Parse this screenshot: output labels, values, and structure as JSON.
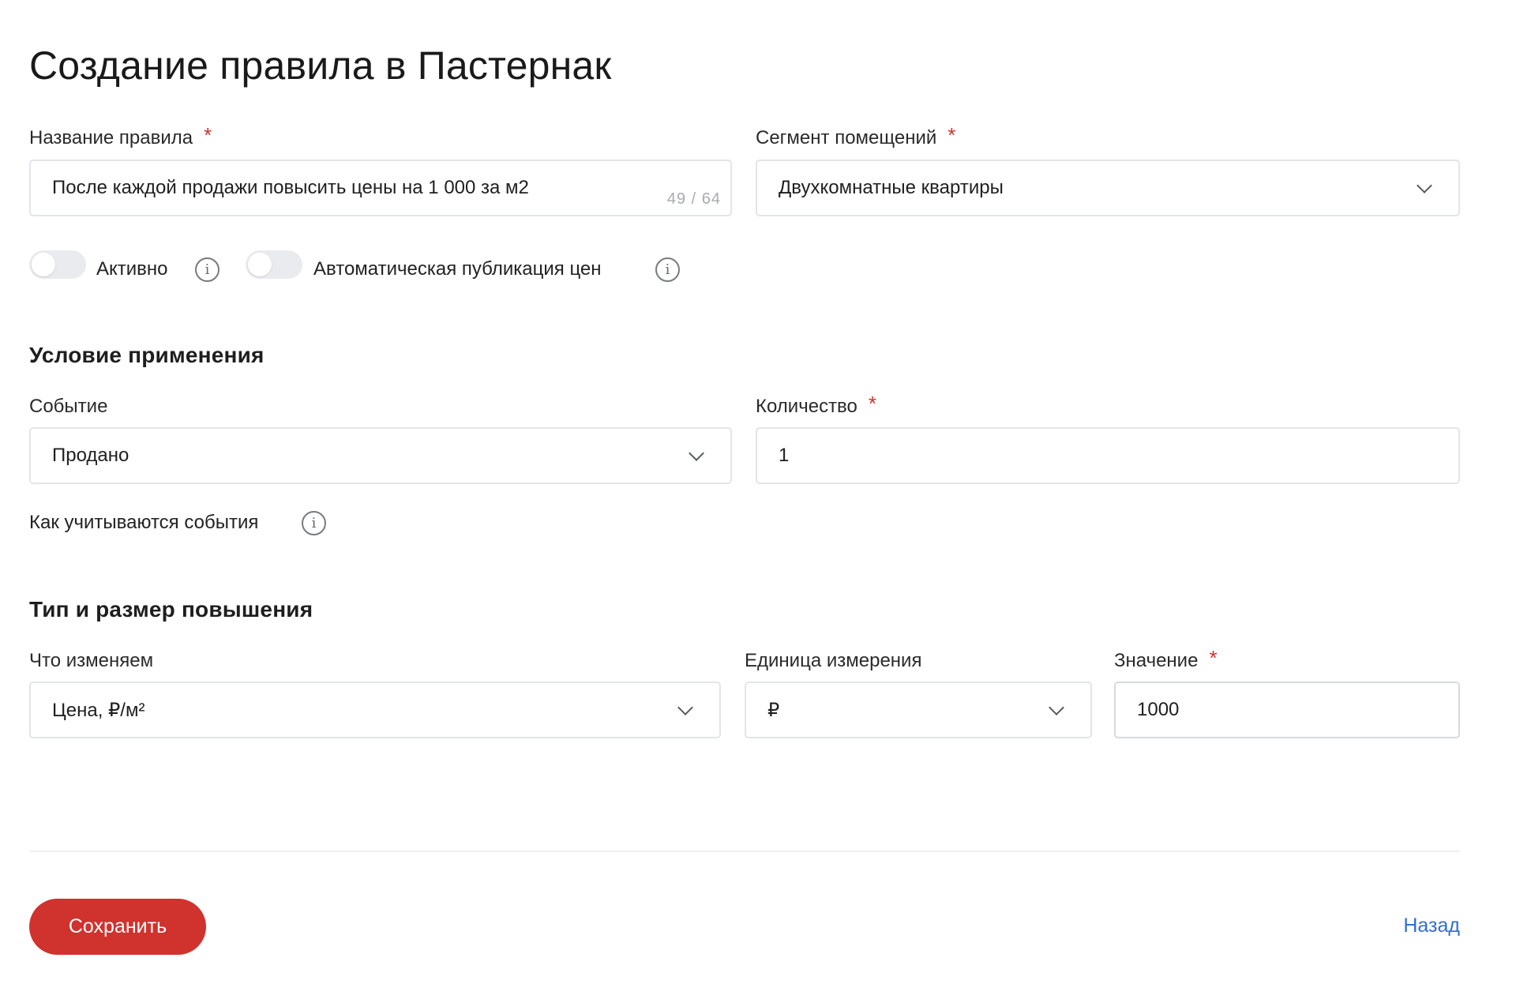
{
  "page": {
    "title": "Создание правила в Пастернак"
  },
  "rule_name": {
    "label": "Название правила",
    "value": "После каждой продажи повысить цены на 1 000 за м2",
    "counter": "49 / 64"
  },
  "segment": {
    "label": "Сегмент помещений",
    "value": "Двухкомнатные квартиры"
  },
  "toggles": {
    "active": {
      "label": "Активно",
      "on": false
    },
    "auto_publish": {
      "label": "Автоматическая публикация цен",
      "on": false
    }
  },
  "condition": {
    "title": "Условие применения",
    "event": {
      "label": "Событие",
      "value": "Продано"
    },
    "quantity": {
      "label": "Количество",
      "value": "1"
    },
    "events_hint": "Как учитываются события"
  },
  "increase": {
    "title": "Тип и размер повышения",
    "what": {
      "label": "Что изменяем",
      "value": "Цена, ₽/м²"
    },
    "unit": {
      "label": "Единица измерения",
      "value": "₽"
    },
    "amount": {
      "label": "Значение",
      "value": "1000"
    }
  },
  "actions": {
    "save_label": "Сохранить",
    "back_label": "Назад"
  },
  "colors": {
    "accent": "#d0322e",
    "link": "#2f6fd1",
    "border": "#e3e5e8"
  },
  "icons": {
    "info": "info-circle-icon",
    "chevron": "chevron-down-icon"
  }
}
